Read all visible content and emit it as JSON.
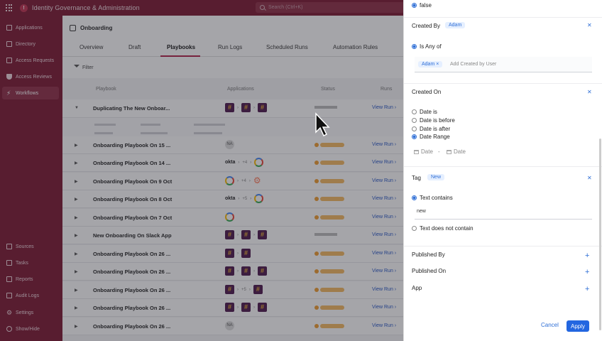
{
  "app": {
    "title": "Identity Governance & Administration",
    "search_placeholder": "Search (Ctrl+K)"
  },
  "sidebar": {
    "top_items": [
      {
        "label": "Applications"
      },
      {
        "label": "Directory"
      },
      {
        "label": "Access Requests"
      },
      {
        "label": "Access Reviews"
      },
      {
        "label": "Workflows"
      }
    ],
    "bottom_items": [
      {
        "label": "Sources"
      },
      {
        "label": "Tasks"
      },
      {
        "label": "Reports"
      },
      {
        "label": "Audit Logs"
      },
      {
        "label": "Settings"
      },
      {
        "label": "Show/Hide"
      }
    ],
    "active": "Workflows"
  },
  "page": {
    "title": "Onboarding",
    "tabs": [
      "Overview",
      "Draft",
      "Playbooks",
      "Run Logs",
      "Scheduled Runs",
      "Automation Rules"
    ],
    "active_tab": "Playbooks",
    "filter_label": "Filter",
    "columns": [
      "Playbook",
      "Applications",
      "Status",
      "Runs"
    ],
    "view_run_label": "View Run",
    "rows": [
      {
        "name": "Duplicating The New Onboar...",
        "status": "gray",
        "expanded": true
      },
      {
        "name": "Onboarding Playbook On 15 ...",
        "status": "orange"
      },
      {
        "name": "Onboarding Playbook On 14 ...",
        "status": "orange"
      },
      {
        "name": "Onboarding Playbook On 9 Oct",
        "status": "orange"
      },
      {
        "name": "Onboarding Playbook On 8 Oct",
        "status": "orange"
      },
      {
        "name": "Onboarding Playbook On 7 Oct",
        "status": "orange"
      },
      {
        "name": "New Onboarding On Slack App",
        "status": "gray"
      },
      {
        "name": "Onboarding Playbook On 26 ...",
        "status": "orange"
      },
      {
        "name": "Onboarding Playbook On 26 ...",
        "status": "orange"
      },
      {
        "name": "Onboarding Playbook On 26 ...",
        "status": "orange"
      },
      {
        "name": "Onboarding Playbook On 26 ...",
        "status": "orange"
      },
      {
        "name": "Onboarding Playbook On 26 ...",
        "status": "orange"
      }
    ],
    "app_na": "NA",
    "app_okta": "okta",
    "plus_counts": [
      "+4",
      "+4",
      "+5",
      "+5"
    ]
  },
  "drawer": {
    "top_value": "false",
    "created_by": {
      "label": "Created By",
      "chip": "Adam",
      "option": "Is Any of",
      "user_chip": "Adam",
      "placeholder": "Add Created by User"
    },
    "created_on": {
      "label": "Created On",
      "options": [
        "Date is",
        "Date is before",
        "Date is after",
        "Date Range"
      ],
      "selected": "Date Range",
      "from": "Date",
      "to": "Date",
      "separator": "-"
    },
    "tag": {
      "label": "Tag",
      "chip": "New",
      "contains": "Text contains",
      "value": "new",
      "not_contains": "Text does not contain"
    },
    "published_by": "Published By",
    "published_on": "Published On",
    "app": "App",
    "cancel": "Cancel",
    "apply": "Apply"
  },
  "colors": {
    "brand": "#7a1530",
    "accent": "#2366e0",
    "status_orange": "#ef9c2e"
  }
}
